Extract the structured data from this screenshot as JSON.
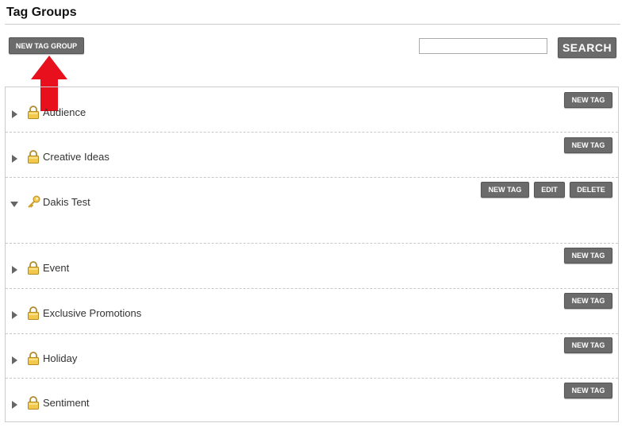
{
  "page": {
    "title": "Tag Groups"
  },
  "toolbar": {
    "new_group_label": "NEW TAG GROUP",
    "search_placeholder": "",
    "search_label": "SEARCH"
  },
  "groups": [
    {
      "name": "Audience",
      "expanded": false,
      "icon": "lock-icon",
      "actions": [
        "NEW TAG"
      ]
    },
    {
      "name": "Creative Ideas",
      "expanded": false,
      "icon": "lock-icon",
      "actions": [
        "NEW TAG"
      ]
    },
    {
      "name": "Dakis Test",
      "expanded": true,
      "icon": "key-icon",
      "actions": [
        "NEW TAG",
        "EDIT",
        "DELETE"
      ]
    },
    {
      "name": "Event",
      "expanded": false,
      "icon": "lock-icon",
      "actions": [
        "NEW TAG"
      ]
    },
    {
      "name": "Exclusive Promotions",
      "expanded": false,
      "icon": "lock-icon",
      "actions": [
        "NEW TAG"
      ]
    },
    {
      "name": "Holiday",
      "expanded": false,
      "icon": "lock-icon",
      "actions": [
        "NEW TAG"
      ]
    },
    {
      "name": "Sentiment",
      "expanded": false,
      "icon": "lock-icon",
      "actions": [
        "NEW TAG"
      ]
    }
  ],
  "colors": {
    "button_bg": "#6b6b6b",
    "annotation_arrow": "#e8101c"
  }
}
